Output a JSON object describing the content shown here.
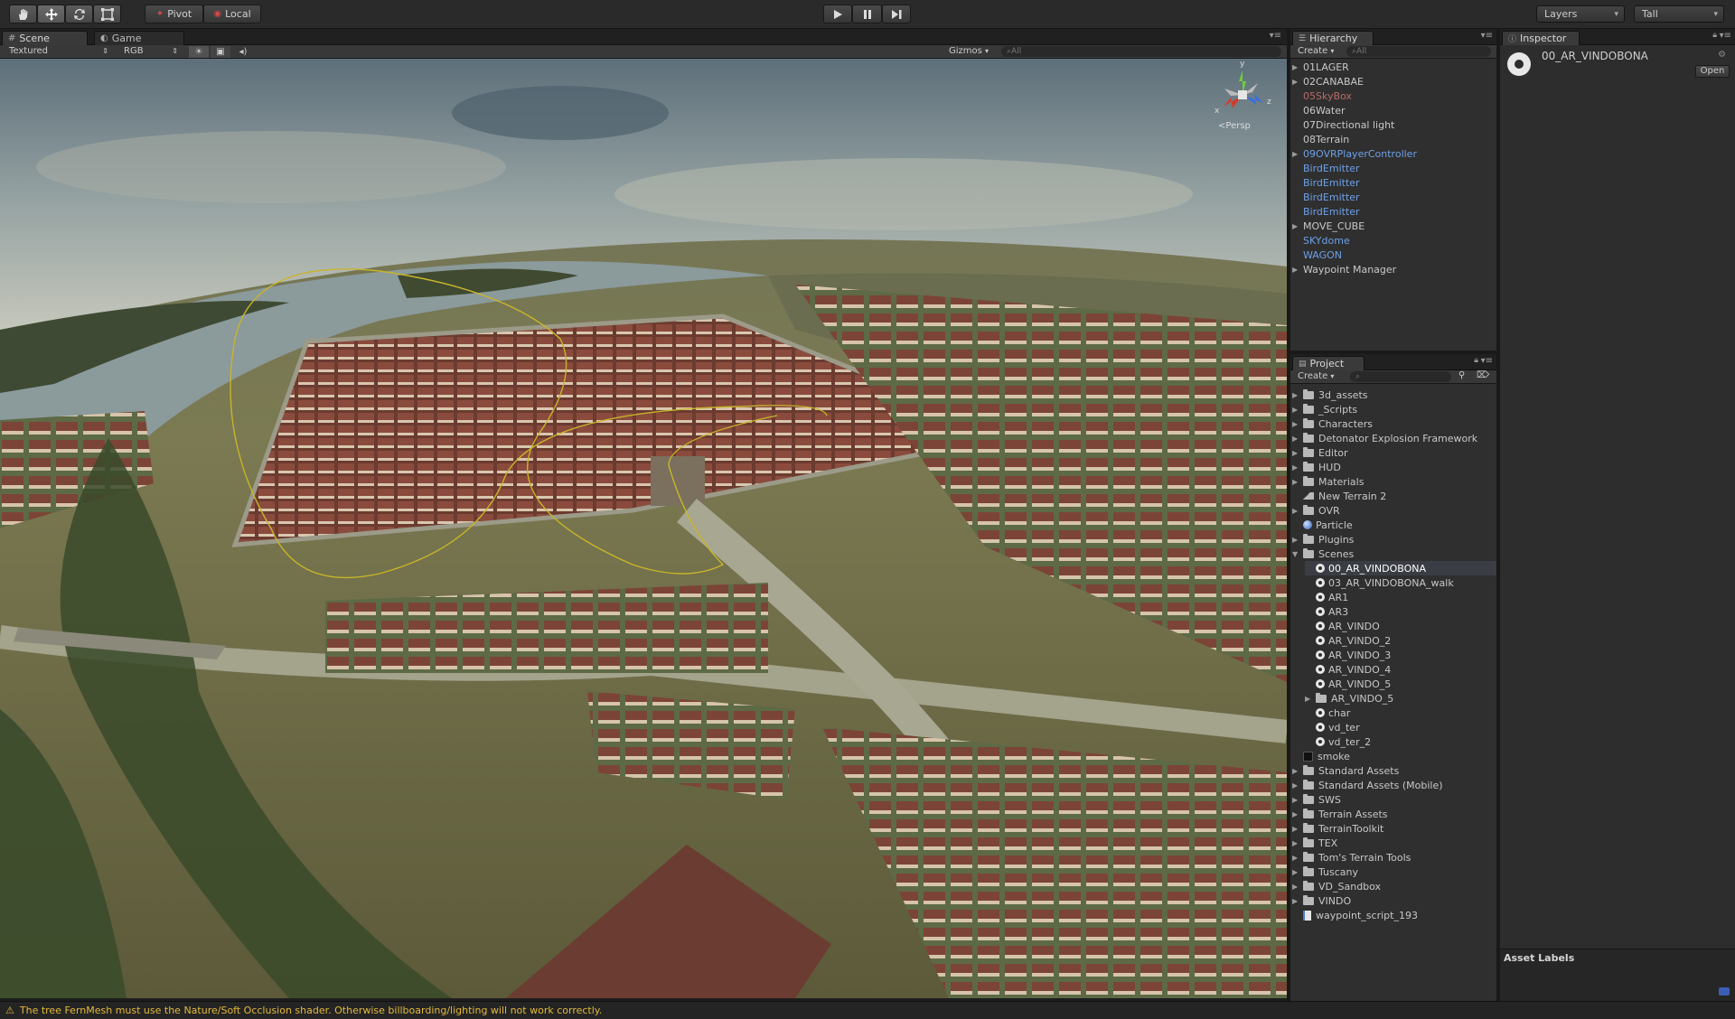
{
  "toolbar": {
    "pivot_label": "Pivot",
    "local_label": "Local",
    "layers_label": "Layers",
    "layout_label": "Tall",
    "tools": [
      "hand-icon",
      "move-icon",
      "rotate-icon",
      "scale-icon"
    ],
    "play_icons": [
      "play-icon",
      "pause-icon",
      "step-icon"
    ]
  },
  "scene": {
    "tab_scene": "Scene",
    "tab_game": "Game",
    "render_mode": "Textured",
    "color_mode": "RGB",
    "gizmos_label": "Gizmos",
    "search_placeholder": "All",
    "persp_label": "Persp",
    "axes": {
      "x": "x",
      "y": "y",
      "z": "z"
    }
  },
  "hierarchy": {
    "title": "Hierarchy",
    "create_label": "Create",
    "search_placeholder": "All",
    "items": [
      {
        "label": "01LAGER",
        "expandable": true,
        "style": "normal"
      },
      {
        "label": "02CANABAE",
        "expandable": true,
        "style": "normal"
      },
      {
        "label": "05SkyBox",
        "expandable": false,
        "style": "red"
      },
      {
        "label": "06Water",
        "expandable": false,
        "style": "normal"
      },
      {
        "label": "07Directional light",
        "expandable": false,
        "style": "normal"
      },
      {
        "label": "08Terrain",
        "expandable": false,
        "style": "normal"
      },
      {
        "label": "09OVRPlayerController",
        "expandable": true,
        "style": "blue"
      },
      {
        "label": "BirdEmitter",
        "expandable": false,
        "style": "blue"
      },
      {
        "label": "BirdEmitter",
        "expandable": false,
        "style": "blue"
      },
      {
        "label": "BirdEmitter",
        "expandable": false,
        "style": "blue"
      },
      {
        "label": "BirdEmitter",
        "expandable": false,
        "style": "blue"
      },
      {
        "label": "MOVE_CUBE",
        "expandable": true,
        "style": "normal"
      },
      {
        "label": "SKYdome",
        "expandable": false,
        "style": "blue"
      },
      {
        "label": "WAGON",
        "expandable": false,
        "style": "blue"
      },
      {
        "label": "Waypoint Manager",
        "expandable": true,
        "style": "normal"
      }
    ]
  },
  "project": {
    "title": "Project",
    "create_label": "Create",
    "items": [
      {
        "label": "3d_assets",
        "kind": "folder",
        "indent": 0
      },
      {
        "label": "_Scripts",
        "kind": "folder",
        "indent": 0
      },
      {
        "label": "Characters",
        "kind": "folder",
        "indent": 0
      },
      {
        "label": "Detonator Explosion Framework",
        "kind": "folder",
        "indent": 0
      },
      {
        "label": "Editor",
        "kind": "folder",
        "indent": 0
      },
      {
        "label": "HUD",
        "kind": "folder",
        "indent": 0
      },
      {
        "label": "Materials",
        "kind": "folder",
        "indent": 0
      },
      {
        "label": "New Terrain 2",
        "kind": "terrain",
        "indent": 0
      },
      {
        "label": "OVR",
        "kind": "folder",
        "indent": 0
      },
      {
        "label": "Particle",
        "kind": "sphere",
        "indent": 0
      },
      {
        "label": "Plugins",
        "kind": "folder",
        "indent": 0
      },
      {
        "label": "Scenes",
        "kind": "folder-open",
        "indent": 0
      },
      {
        "label": "00_AR_VINDOBONA",
        "kind": "scene",
        "indent": 1,
        "selected": true
      },
      {
        "label": "03_AR_VINDOBONA_walk",
        "kind": "scene",
        "indent": 1
      },
      {
        "label": "AR1",
        "kind": "scene",
        "indent": 1
      },
      {
        "label": "AR3",
        "kind": "scene",
        "indent": 1
      },
      {
        "label": "AR_VINDO",
        "kind": "scene",
        "indent": 1
      },
      {
        "label": "AR_VINDO_2",
        "kind": "scene",
        "indent": 1
      },
      {
        "label": "AR_VINDO_3",
        "kind": "scene",
        "indent": 1
      },
      {
        "label": "AR_VINDO_4",
        "kind": "scene",
        "indent": 1
      },
      {
        "label": "AR_VINDO_5",
        "kind": "scene",
        "indent": 1
      },
      {
        "label": "AR_VINDO_5",
        "kind": "folder",
        "indent": 1
      },
      {
        "label": "char",
        "kind": "scene",
        "indent": 1
      },
      {
        "label": "vd_ter",
        "kind": "scene",
        "indent": 1
      },
      {
        "label": "vd_ter_2",
        "kind": "scene",
        "indent": 1
      },
      {
        "label": "smoke",
        "kind": "dark",
        "indent": 0
      },
      {
        "label": "Standard Assets",
        "kind": "folder",
        "indent": 0
      },
      {
        "label": "Standard Assets (Mobile)",
        "kind": "folder",
        "indent": 0
      },
      {
        "label": "SWS",
        "kind": "folder",
        "indent": 0
      },
      {
        "label": "Terrain Assets",
        "kind": "folder",
        "indent": 0
      },
      {
        "label": "TerrainToolkit",
        "kind": "folder",
        "indent": 0
      },
      {
        "label": "TEX",
        "kind": "folder",
        "indent": 0
      },
      {
        "label": "Tom's Terrain Tools",
        "kind": "folder",
        "indent": 0
      },
      {
        "label": "Tuscany",
        "kind": "folder",
        "indent": 0
      },
      {
        "label": "VD_Sandbox",
        "kind": "folder",
        "indent": 0
      },
      {
        "label": "VINDO",
        "kind": "folder",
        "indent": 0
      },
      {
        "label": "waypoint_script_193",
        "kind": "script",
        "indent": 0
      }
    ]
  },
  "inspector": {
    "title": "Inspector",
    "object_name": "00_AR_VINDOBONA",
    "open_label": "Open",
    "asset_labels": "Asset Labels"
  },
  "status": {
    "message": "The tree FernMesh must use the Nature/Soft Occlusion shader. Otherwise billboarding/lighting will not work correctly."
  },
  "colors": {
    "selection_path": "#c8b42a",
    "warning": "#e3b93b",
    "blue_object": "#6ea0e8",
    "prefab_broken": "#b96a6a"
  }
}
